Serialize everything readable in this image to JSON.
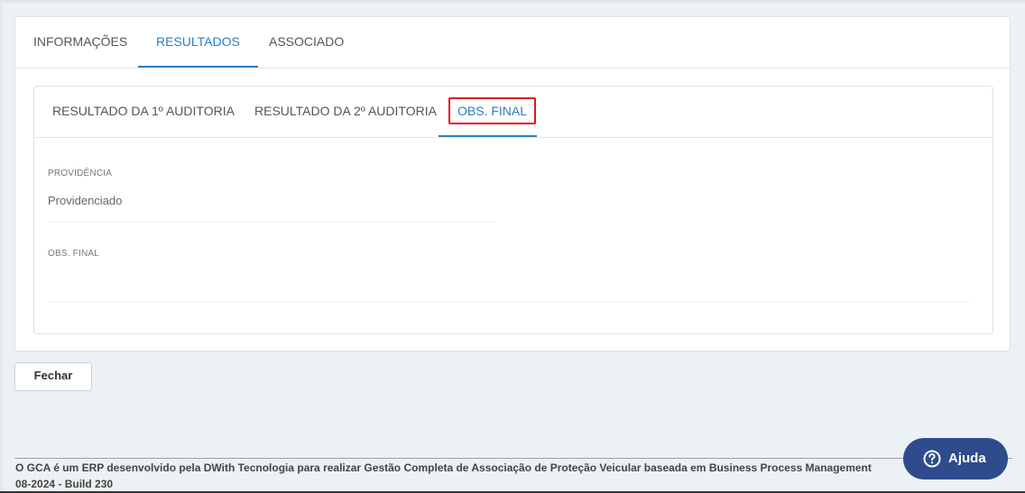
{
  "tabs": [
    {
      "label": "INFORMAÇÕES"
    },
    {
      "label": "RESULTADOS"
    },
    {
      "label": "ASSOCIADO"
    }
  ],
  "sub_tabs": [
    {
      "label": "RESULTADO DA 1º AUDITORIA"
    },
    {
      "label": "RESULTADO DA 2º AUDITORIA"
    },
    {
      "label": "OBS. FINAL"
    }
  ],
  "form": {
    "providencia_label": "PROVIDÊNCIA",
    "providencia_value": "Providenciado",
    "obs_final_label": "OBS. FINAL",
    "obs_final_value": ""
  },
  "actions": {
    "close_label": "Fechar"
  },
  "footer": {
    "line1": "O GCA é um ERP desenvolvido pela DWith Tecnologia para realizar Gestão Completa de Associação de Proteção Veicular baseada em Business Process Management",
    "line2": "08-2024 - Build 230"
  },
  "help": {
    "label": "Ajuda",
    "icon": "question-circle-icon"
  },
  "colors": {
    "accent": "#2a7fc1",
    "highlight": "#e3141b",
    "help_button": "#2e4b8c"
  }
}
